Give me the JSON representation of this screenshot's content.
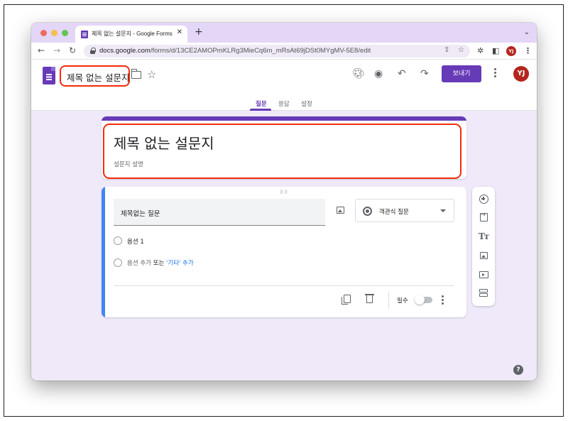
{
  "browser": {
    "tab_title": "제목 없는 설문지 - Google Forms",
    "tab_close": "✕",
    "new_tab": "+",
    "tab_list": "⌄",
    "url_host": "docs.google.com",
    "url_path": "/forms/d/13CE2AMOPmKLRg3MieCq6m_mRsAt69jDSt0MYgMV-5E8/edit",
    "profile_initials": "YJ",
    "icons": [
      "back-icon",
      "forward-icon",
      "reload-icon",
      "lock-icon",
      "share-icon",
      "bookmark-star-icon",
      "extensions-icon",
      "side-panel-icon",
      "menu-icon"
    ]
  },
  "header": {
    "doc_title": "제목 없는 설문지",
    "send_label": "보내기",
    "avatar_initials": "YJ",
    "icons": [
      "forms-logo-icon",
      "folder-icon",
      "star-icon",
      "palette-icon",
      "preview-eye-icon",
      "undo-icon",
      "redo-icon",
      "more-vert-icon"
    ]
  },
  "tabs": [
    {
      "label": "질문",
      "active": true
    },
    {
      "label": "응답",
      "active": false
    },
    {
      "label": "설정",
      "active": false
    }
  ],
  "form": {
    "title": "제목 없는 설문지",
    "description_placeholder": "설문지 설명"
  },
  "question": {
    "title": "제목없는 질문",
    "type": "객관식 질문",
    "options": [
      "옵션 1"
    ],
    "add_option": "옵션 추가",
    "or": "또는",
    "add_other": "'기타' 추가",
    "required_label": "필수",
    "required": false
  },
  "side_toolbar": [
    "add-question-icon",
    "import-questions-icon",
    "add-title-icon",
    "add-image-icon",
    "add-video-icon",
    "add-section-icon"
  ],
  "colors": {
    "accent": "#673ab7",
    "tab_strip": "#e4d6f7",
    "canvas": "#efe9f9",
    "question_bar": "#4285f4",
    "annotation": "#f42a0c",
    "avatar": "#b3261e"
  },
  "help_label": "?"
}
